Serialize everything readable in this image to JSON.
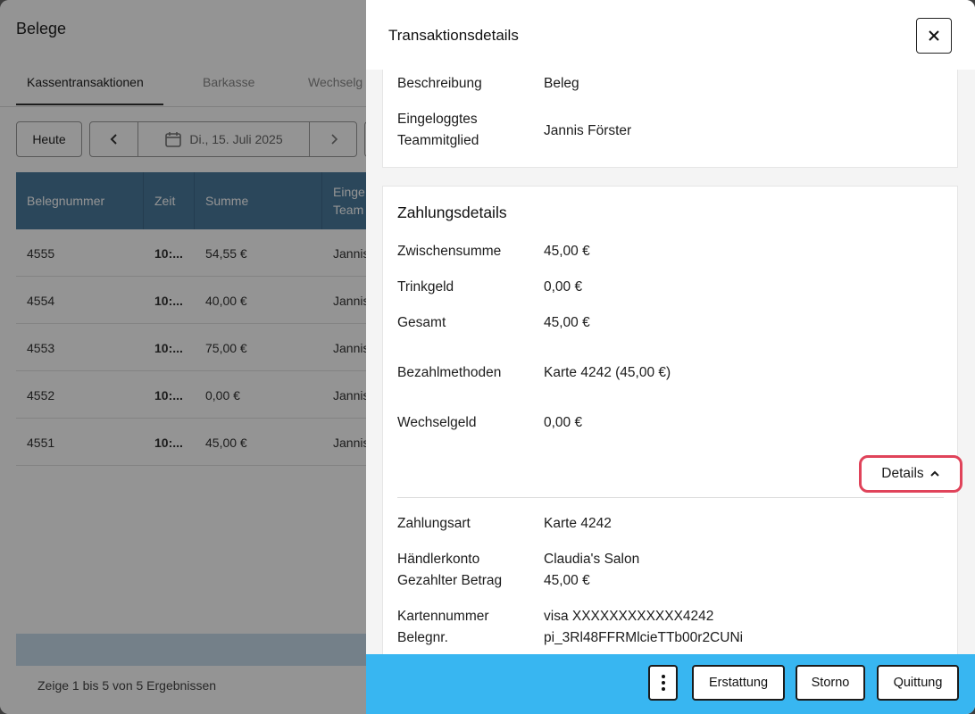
{
  "background": {
    "title": "Belege",
    "tabs": [
      "Kassentransaktionen",
      "Barkasse",
      "Wechselg"
    ],
    "today_button": "Heute",
    "date_label": "Di., 15. Juli 2025",
    "table": {
      "headers": [
        "Belegnummer",
        "Zeit",
        "Summe",
        "Einge\nTeam"
      ],
      "rows": [
        {
          "nr": "4555",
          "zeit": "10:...",
          "summe": "54,55 €",
          "team": "Jannis"
        },
        {
          "nr": "4554",
          "zeit": "10:...",
          "summe": "40,00 €",
          "team": "Jannis"
        },
        {
          "nr": "4553",
          "zeit": "10:...",
          "summe": "75,00 €",
          "team": "Jannis"
        },
        {
          "nr": "4552",
          "zeit": "10:...",
          "summe": "0,00 €",
          "team": "Jannis"
        },
        {
          "nr": "4551",
          "zeit": "10:...",
          "summe": "45,00 €",
          "team": "Jannis"
        }
      ]
    },
    "footer_text": "Zeige 1 bis 5 von 5 Ergebnissen"
  },
  "drawer": {
    "title": "Transaktionsdetails",
    "info": {
      "description_label": "Beschreibung",
      "description_value": "Beleg",
      "member_label_1": "Eingeloggtes",
      "member_label_2": "Teammitglied",
      "member_value": "Jannis Förster"
    },
    "payment": {
      "title": "Zahlungsdetails",
      "subtotal_label": "Zwischensumme",
      "subtotal_value": "45,00 €",
      "tip_label": "Trinkgeld",
      "tip_value": "0,00 €",
      "total_label": "Gesamt",
      "total_value": "45,00 €",
      "methods_label": "Bezahlmethoden",
      "methods_value": "Karte 4242 (45,00 €)",
      "change_label": "Wechselgeld",
      "change_value": "0,00 €",
      "details_button": "Details",
      "type_label": "Zahlungsart",
      "type_value": "Karte 4242",
      "merchant_label": "Händlerkonto",
      "merchant_value": "Claudia's Salon",
      "paid_label": "Gezahlter Betrag",
      "paid_value": "45,00 €",
      "card_label": "Kartennummer",
      "card_value": "visa XXXXXXXXXXXX4242",
      "receipt_label": "Belegnr.",
      "receipt_value": "pi_3Rl48FFRMlcieTTb00r2CUNi"
    },
    "actions": {
      "refund": "Erstattung",
      "cancel": "Storno",
      "receipt": "Quittung"
    }
  },
  "colors": {
    "table_header": "#4a7a9e",
    "action_bar": "#38b6f1",
    "highlight": "#e0435a"
  }
}
